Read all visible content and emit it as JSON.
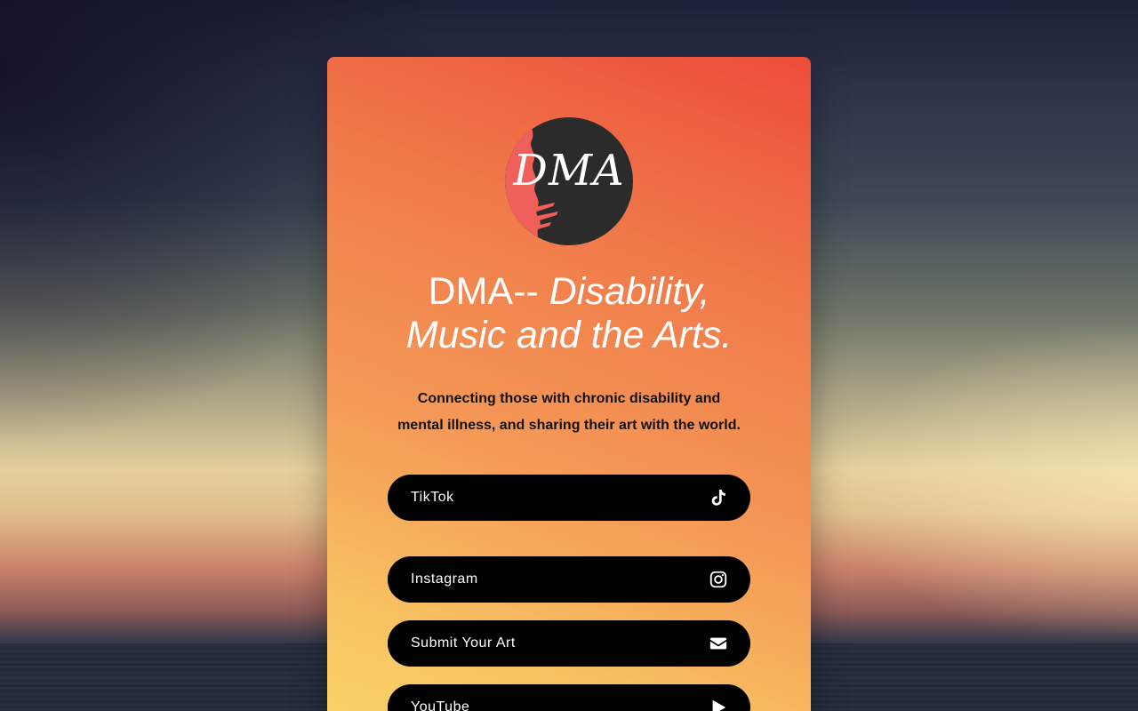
{
  "profile": {
    "logo_text": "DMA",
    "title_plain": "DMA-- ",
    "title_italic": "Disability, Music and the Arts.",
    "description": "Connecting those with chronic disability and mental illness, and sharing their art with the world."
  },
  "links": [
    {
      "label": "TikTok",
      "icon": "tiktok-icon"
    },
    {
      "label": "Instagram",
      "icon": "instagram-icon"
    },
    {
      "label": "Submit Your Art",
      "icon": "envelope-icon"
    },
    {
      "label": "YouTube",
      "icon": "play-icon"
    }
  ],
  "colors": {
    "card_gradient_top": "#ed4c3a",
    "card_gradient_bottom": "#fad268",
    "button_bg": "#000000",
    "button_text": "#ffffff",
    "logo_bg": "#2b2b2b",
    "logo_splash": "#f0605a"
  }
}
